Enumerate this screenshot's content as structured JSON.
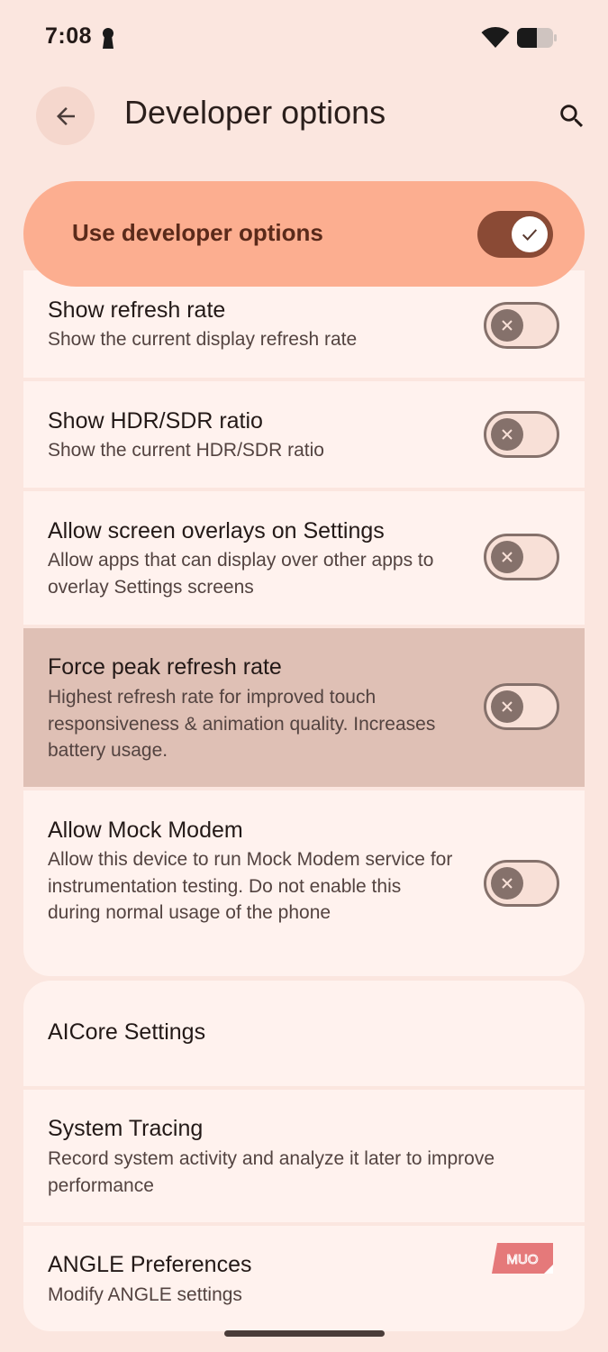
{
  "status_bar": {
    "time": "7:08"
  },
  "header": {
    "title": "Developer options",
    "back_icon": "arrow-back-icon",
    "search_icon": "search-icon"
  },
  "master_toggle": {
    "label": "Use developer options",
    "checked": true
  },
  "settings": {
    "items": [
      {
        "title": "Show refresh rate",
        "summary": "Show the current display refresh rate",
        "checked": false
      },
      {
        "title": "Show HDR/SDR ratio",
        "summary": "Show the current HDR/SDR ratio",
        "checked": false
      },
      {
        "title": "Allow screen overlays on Settings",
        "summary": "Allow apps that can display over other apps to overlay Settings screens",
        "checked": false
      },
      {
        "title": "Force peak refresh rate",
        "summary": "Highest refresh rate for improved touch responsiveness & animation quality. Increases battery usage.",
        "checked": false,
        "highlighted": true
      },
      {
        "title": "Allow Mock Modem",
        "summary": "Allow this device to run Mock Modem service for instrumentation testing. Do not enable this during normal usage of the phone",
        "checked": false
      }
    ],
    "links": [
      {
        "title": "AICore Settings"
      },
      {
        "title": "System Tracing",
        "summary": "Record system activity and analyze it later to improve performance"
      },
      {
        "title": "ANGLE Preferences",
        "summary": "Modify ANGLE settings"
      }
    ]
  },
  "watermark": {
    "text": "MUO"
  },
  "colors": {
    "background": "#fbe6df",
    "accent": "#fcae90",
    "switch_on": "#8a4a35",
    "card": "#fff2ee",
    "highlight": "#dfc0b5"
  }
}
